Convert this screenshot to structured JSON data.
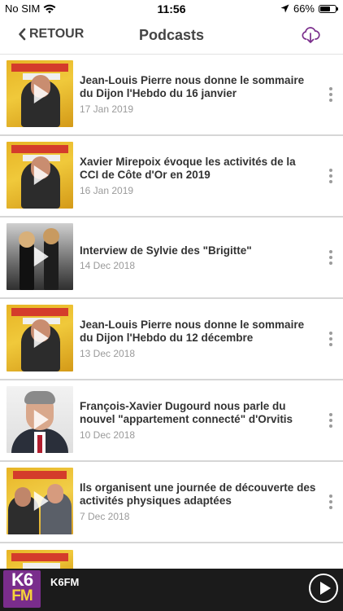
{
  "status_bar": {
    "carrier": "No SIM",
    "time": "11:56",
    "battery_text": "66%",
    "battery_level": 0.66,
    "icons": [
      "wifi-icon",
      "location-arrow-icon",
      "battery-icon"
    ]
  },
  "nav": {
    "back_label": "RETOUR",
    "title": "Podcasts",
    "download_icon": "cloud-download-icon",
    "accent_color": "#7a2d8c"
  },
  "podcasts": [
    {
      "title": "Jean-Louis Pierre nous donne le sommaire du Dijon l'Hebdo du 16 janvier",
      "date": "17 Jan 2019",
      "thumb": "radio-studio"
    },
    {
      "title": "Xavier Mirepoix évoque les activités de la CCI de Côte d'Or en 2019",
      "date": "16 Jan 2019",
      "thumb": "radio-studio"
    },
    {
      "title": "Interview de Sylvie des \"Brigitte\"",
      "date": "14 Dec 2018",
      "thumb": "stage"
    },
    {
      "title": "Jean-Louis Pierre nous donne le sommaire du Dijon l'Hebdo du 12 décembre",
      "date": "13 Dec 2018",
      "thumb": "radio-studio"
    },
    {
      "title": "François-Xavier Dugourd nous parle du nouvel \"appartement connecté\" d'Orvitis",
      "date": "10 Dec 2018",
      "thumb": "portrait"
    },
    {
      "title": "Ils organisent une journée de découverte des activités physiques adaptées",
      "date": "7 Dec 2018",
      "thumb": "duo"
    }
  ],
  "player": {
    "logo_top": "K6",
    "logo_bottom": "FM",
    "station": "K6FM",
    "bar_color": "#1b1b1b"
  }
}
